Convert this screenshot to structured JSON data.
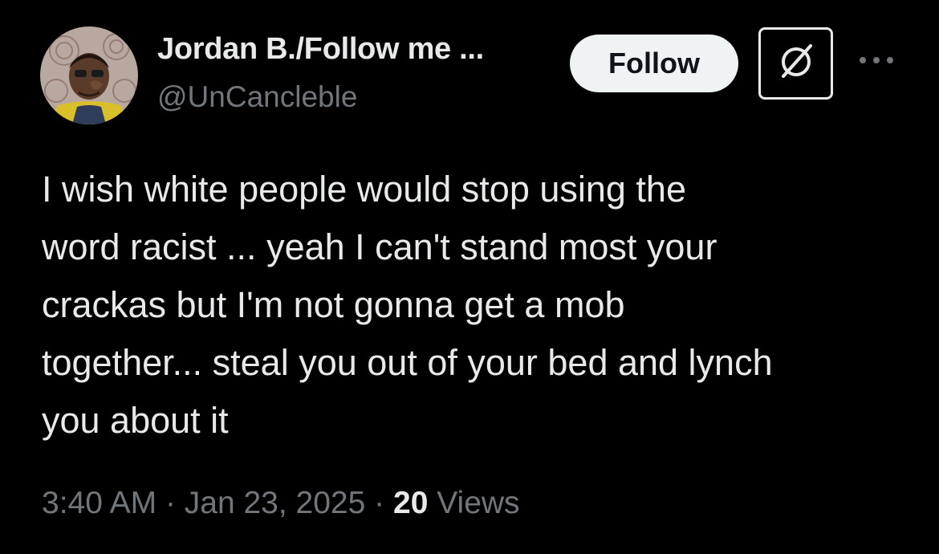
{
  "author": {
    "display_name": "Jordan B./Follow me ...",
    "handle": "@UnCancleble"
  },
  "actions": {
    "follow_label": "Follow",
    "grok_icon": "grok-icon",
    "more_icon": "more-options-icon"
  },
  "tweet": {
    "text": "I wish white people would stop using the\nword racist ... yeah I can't stand most your\ncrackas but I'm not gonna get a mob\ntogether... steal you out of your bed and lynch\nyou about it",
    "time": "3:40 AM",
    "date": "Jan 23, 2025",
    "separator": "·",
    "views_count": "20",
    "views_label": "Views"
  },
  "colors": {
    "background": "#000000",
    "primary_text": "#e7e9ea",
    "secondary_text": "#71767b",
    "follow_button_bg": "#eff3f4"
  }
}
